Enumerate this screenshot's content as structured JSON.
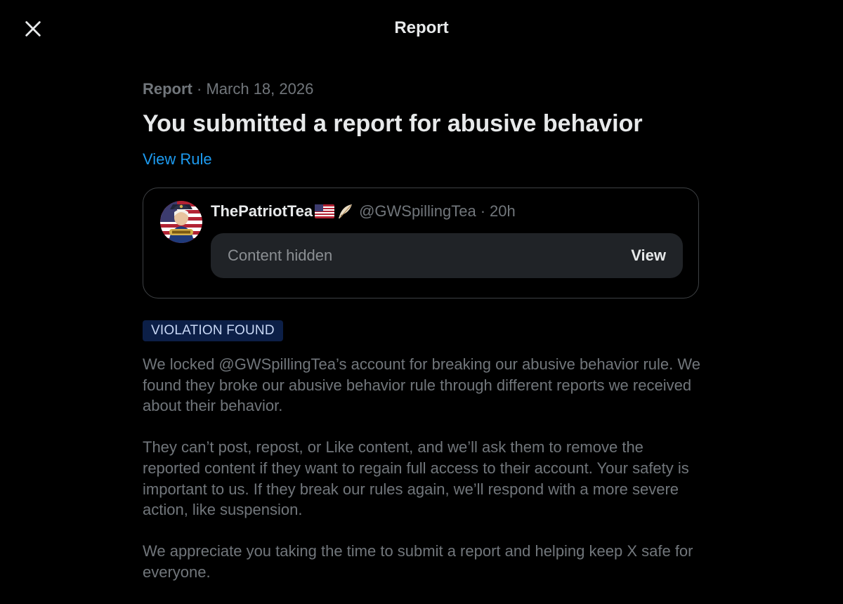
{
  "header": {
    "title": "Report",
    "close_icon": "close-icon"
  },
  "report": {
    "label": "Report",
    "separator": " · ",
    "date": "March 18, 2026",
    "headline": "You submitted a report for abusive behavior",
    "view_rule": "View Rule"
  },
  "post": {
    "avatar_icon": "avatar-image",
    "display_name": "ThePatriotTea",
    "badges": [
      "us-flag-icon",
      "feather-icon"
    ],
    "handle": "@GWSpillingTea",
    "separator": "·",
    "time": "20h",
    "hidden_text": "Content hidden",
    "view_label": "View"
  },
  "status": {
    "badge": "VIOLATION FOUND",
    "badge_color": "#0c1f47"
  },
  "body": {
    "paragraphs": [
      "We locked @GWSpillingTea’s account for breaking our abusive behavior rule. We found they broke our abusive behavior rule through different reports we received about their behavior.",
      "They can’t post, repost, or Like content, and we’ll ask them to remove the reported content if they want to regain full access to their account. Your safety is important to us. If they break our rules again, we’ll respond with a more severe action, like suspension.",
      "We appreciate you taking the time to submit a report and helping keep X safe for everyone."
    ]
  },
  "colors": {
    "background": "#000000",
    "primary_text": "#e7e9ea",
    "secondary_text": "#71767b",
    "link": "#1d9bf0"
  }
}
